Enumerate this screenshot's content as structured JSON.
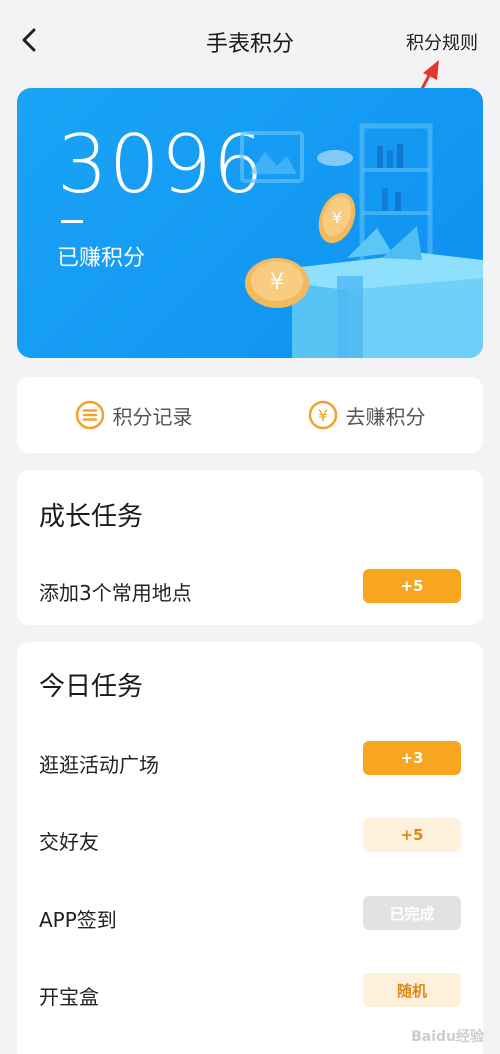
{
  "header": {
    "title": "手表积分",
    "rules_label": "积分规则"
  },
  "hero": {
    "points": "3096",
    "points_label": "已赚积分"
  },
  "actions": {
    "records_label": "积分记录",
    "earn_label": "去赚积分"
  },
  "growth": {
    "title": "成长任务",
    "tasks": [
      {
        "label": "添加3个常用地点",
        "badge": "+5",
        "state": "solid"
      }
    ]
  },
  "daily": {
    "title": "今日任务",
    "tasks": [
      {
        "label": "逛逛活动广场",
        "badge": "+3",
        "state": "solid"
      },
      {
        "label": "交好友",
        "badge": "+5",
        "state": "light"
      },
      {
        "label": "APP签到",
        "badge": "已完成",
        "state": "done"
      },
      {
        "label": "开宝盒",
        "badge": "随机",
        "state": "light"
      }
    ]
  },
  "watermark": "Baidu经验",
  "colors": {
    "hero_blue": "#149af3",
    "badge_orange": "#f8a520",
    "badge_light": "#fdf0dc",
    "badge_done": "#e2e2e2",
    "icon_orange": "#f3a32a",
    "arrow_red": "#e0382c"
  }
}
